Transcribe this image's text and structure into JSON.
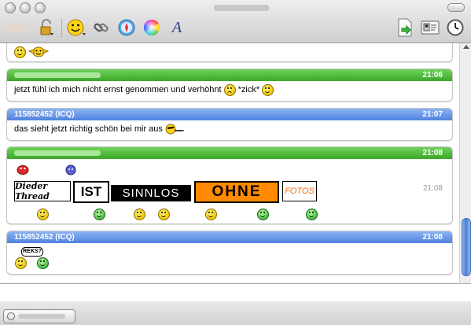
{
  "toolbar": {
    "font_label": "A"
  },
  "messages": [
    {
      "kind": "green",
      "name": "",
      "time": "",
      "text": ""
    },
    {
      "kind": "green",
      "name": "",
      "time": "21:06",
      "text": "jetzt fühl ich mich nicht ernst genommen und verhöhnt",
      "suffix": "*zick*"
    },
    {
      "kind": "blue",
      "name": "115852452 (ICQ)",
      "time": "21:07",
      "text": "das sieht jetzt richtig schön bei mir aus"
    },
    {
      "kind": "green",
      "name": "",
      "time": "21:08",
      "inline_time": "21:08",
      "signs": [
        "Dieder Thread",
        "IST",
        "SINNLOS",
        "OHNE",
        "FOTOS"
      ]
    },
    {
      "kind": "blue",
      "name": "115852452 (ICQ)",
      "time": "21:08",
      "bubble": "REKS?"
    }
  ],
  "colors": {
    "green_header": "#3aa827",
    "blue_header": "#4f82e0",
    "ohne_bg": "#ff8a00",
    "fotos_text": "#ff6a00"
  }
}
